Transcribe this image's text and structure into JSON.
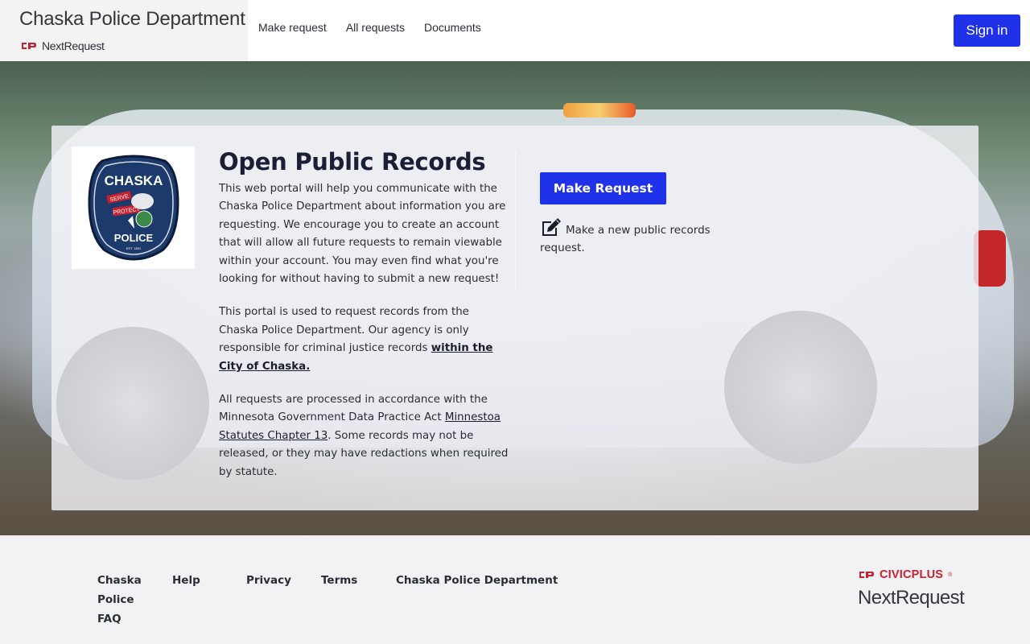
{
  "header": {
    "org_name": "Chaska Police Department",
    "product_name": "NextRequest",
    "nav": [
      "Make request",
      "All requests",
      "Documents"
    ],
    "signin_label": "Sign in"
  },
  "hero": {
    "badge": {
      "top_text": "CHASKA",
      "banner1": "SERVE",
      "banner2": "PROTECT",
      "bottom_text": "POLICE",
      "est": "EST. 1891"
    },
    "title": "Open Public Records",
    "para1": "This web portal will help you communicate with the Chaska Police Department about information you are requesting. We encourage you to create an account that will allow all future requests to remain viewable within your account. You may even find what you're looking for without having to submit a new request!",
    "para2_prefix": "This portal is used to request records from the Chaska Police Department. Our agency is only responsible for criminal justice records ",
    "para2_link": "within the City of Chaska.",
    "para3_prefix": "All requests are processed in accordance with the Minnesota Government Data Practice Act ",
    "para3_link": "Minnestoa Statutes Chapter 13",
    "para3_suffix": ". Some records may not be released, or they may have redactions when required by statute.",
    "make_request_label": "Make Request",
    "make_request_desc": "Make a new public records request."
  },
  "footer": {
    "links": [
      "Chaska Police FAQ",
      "Help",
      "Privacy",
      "Terms",
      "Chaska Police Department"
    ],
    "civic_brand": "CIVICPLUS",
    "civic_tm": "®",
    "product_name": "NextRequest"
  },
  "colors": {
    "primary": "#1f32ea",
    "civic_red": "#c8202f",
    "badge_navy": "#1c3a6b"
  },
  "icons": {
    "brand": "civicplus-logo-icon",
    "make_request": "edit-icon"
  }
}
